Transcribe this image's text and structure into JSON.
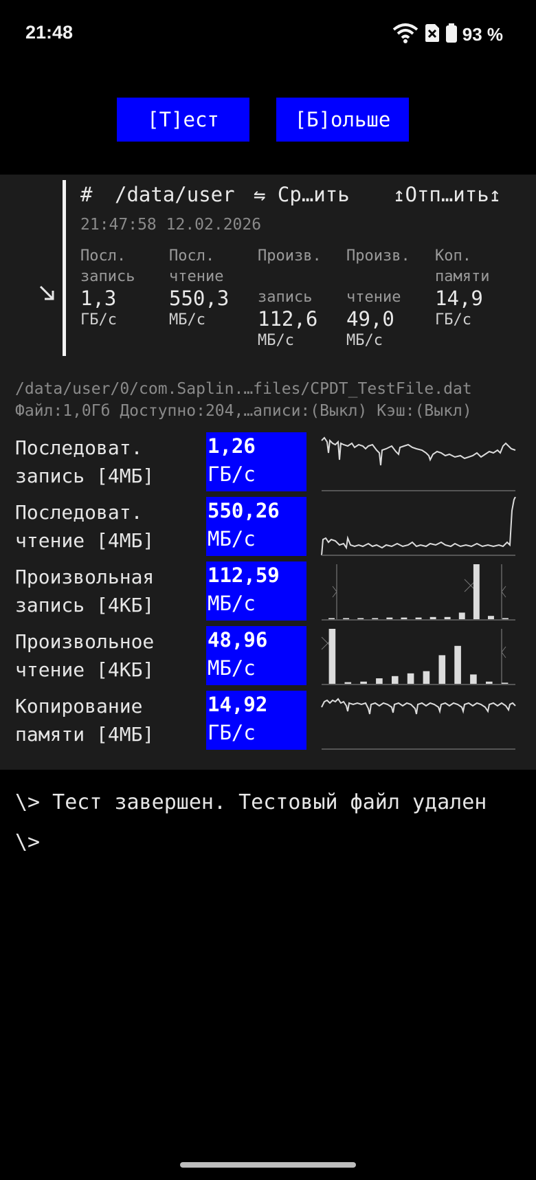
{
  "status_bar": {
    "time": "21:48",
    "battery": "93 %",
    "icons": [
      "wifi-icon",
      "no-sim-icon",
      "battery-icon"
    ]
  },
  "toolbar": {
    "test_label": "[Т]ест",
    "more_label": "[Б]ольше",
    "accent_color": "#0000ff"
  },
  "result_card": {
    "hash": "#",
    "path": "/data/user",
    "compare_label": "⇋ Ср…ить",
    "share_label": "↥Отп…ить↥",
    "timestamp": "21:47:58 12.02.2026",
    "metrics": [
      {
        "label1": "Посл.",
        "label2": "запись",
        "value": "1,3",
        "unit": "ГБ/с"
      },
      {
        "label1": "Посл.",
        "label2": "чтение",
        "value": "550,3",
        "unit": "МБ/с"
      },
      {
        "label1": "Произв.",
        "label2": "запись",
        "value": "112,6",
        "unit": "МБ/с"
      },
      {
        "label1": "Произв.",
        "label2": "чтение",
        "value": "49,0",
        "unit": "МБ/с"
      },
      {
        "label1": "Коп.",
        "label2": "памяти",
        "value": "14,9",
        "unit": "ГБ/с"
      }
    ]
  },
  "file_info": {
    "path": "/data/user/0/com.Saplin.…files/CPDT_TestFile.dat",
    "details": "Файл:1,0Гб Доступно:204,…аписи:(Выкл) Кэш:(Выкл)"
  },
  "tests": [
    {
      "line1": "Последоват.",
      "line2": "запись [4МБ]",
      "value": "1,26",
      "unit": "ГБ/с",
      "graph": "line"
    },
    {
      "line1": "Последоват.",
      "line2": "чтение [4МБ]",
      "value": "550,26",
      "unit": "МБ/с",
      "graph": "line"
    },
    {
      "line1": "Произвольная",
      "line2": "запись [4КБ]",
      "value": "112,59",
      "unit": "МБ/с",
      "graph": "bars",
      "bars": [
        0.02,
        0.02,
        0.02,
        0.02,
        0.03,
        0.03,
        0.03,
        0.04,
        0.04,
        0.12,
        1.0,
        0.06,
        0.02
      ]
    },
    {
      "line1": "Произвольное",
      "line2": "чтение [4КБ]",
      "value": "48,96",
      "unit": "МБ/с",
      "graph": "bars",
      "bars": [
        1.0,
        0.03,
        0.04,
        0.1,
        0.14,
        0.19,
        0.23,
        0.52,
        0.69,
        0.17,
        0.04,
        0.02
      ]
    },
    {
      "line1": "Копирование",
      "line2": "памяти [4МБ]",
      "value": "14,92",
      "unit": "ГБ/с",
      "graph": "line"
    }
  ],
  "console": {
    "line1": "\\> Тест завершен. Тестовый файл удален",
    "line2": "\\>"
  }
}
